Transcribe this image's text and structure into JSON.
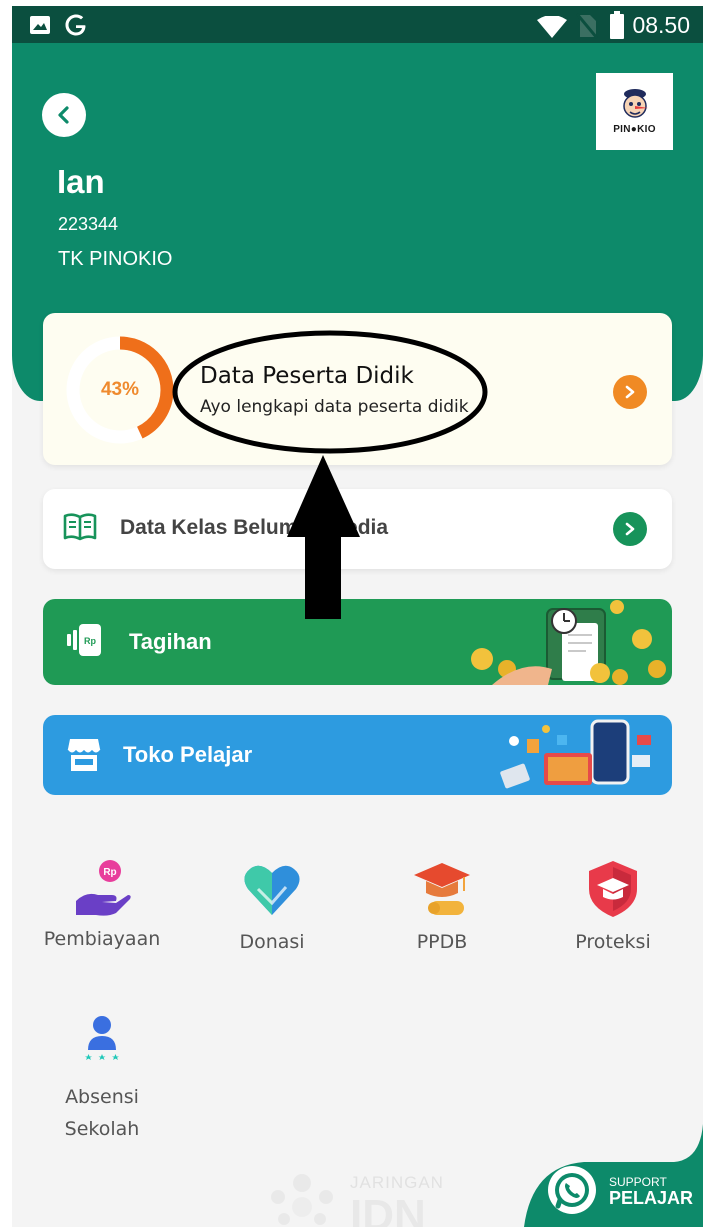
{
  "status_bar": {
    "time": "08.50",
    "icons": [
      "image-icon",
      "google-icon",
      "wifi-icon",
      "no-sim-icon",
      "battery-icon"
    ]
  },
  "header": {
    "student_name": "Ian",
    "student_id": "223344",
    "school_name": "TK PINOKIO",
    "logo_text": "PIN●KIO"
  },
  "data_card": {
    "progress": 43,
    "progress_label": "43%",
    "title": "Data Peserta Didik",
    "subtitle": "Ayo lengkapi data peserta didik",
    "accent": "#f08a24"
  },
  "kelas_card": {
    "label": "Data Kelas Belum Tersedia",
    "accent": "#17935a"
  },
  "tagihan_card": {
    "label": "Tagihan",
    "icon_text": "Rp",
    "color": "#1f9a55"
  },
  "toko_card": {
    "label": "Toko Pelajar",
    "color": "#2d9be0"
  },
  "menu": {
    "items": [
      {
        "label": "Pembiayaan",
        "icon": "financing-icon"
      },
      {
        "label": "Donasi",
        "icon": "donation-icon"
      },
      {
        "label": "PPDB",
        "icon": "graduation-icon"
      },
      {
        "label": "Proteksi",
        "icon": "protection-icon"
      },
      {
        "label_line1": "Absensi",
        "label_line2": "Sekolah",
        "icon": "attendance-icon"
      }
    ]
  },
  "watermark": {
    "top": "JARINGAN",
    "big": "IDN"
  },
  "support": {
    "top": "SUPPORT",
    "bottom": "PELAJAR",
    "color": "#0d8a6a"
  },
  "colors": {
    "primary": "#0d8a6a",
    "status_bar": "#0b4f3f",
    "annotation": "#000000"
  }
}
